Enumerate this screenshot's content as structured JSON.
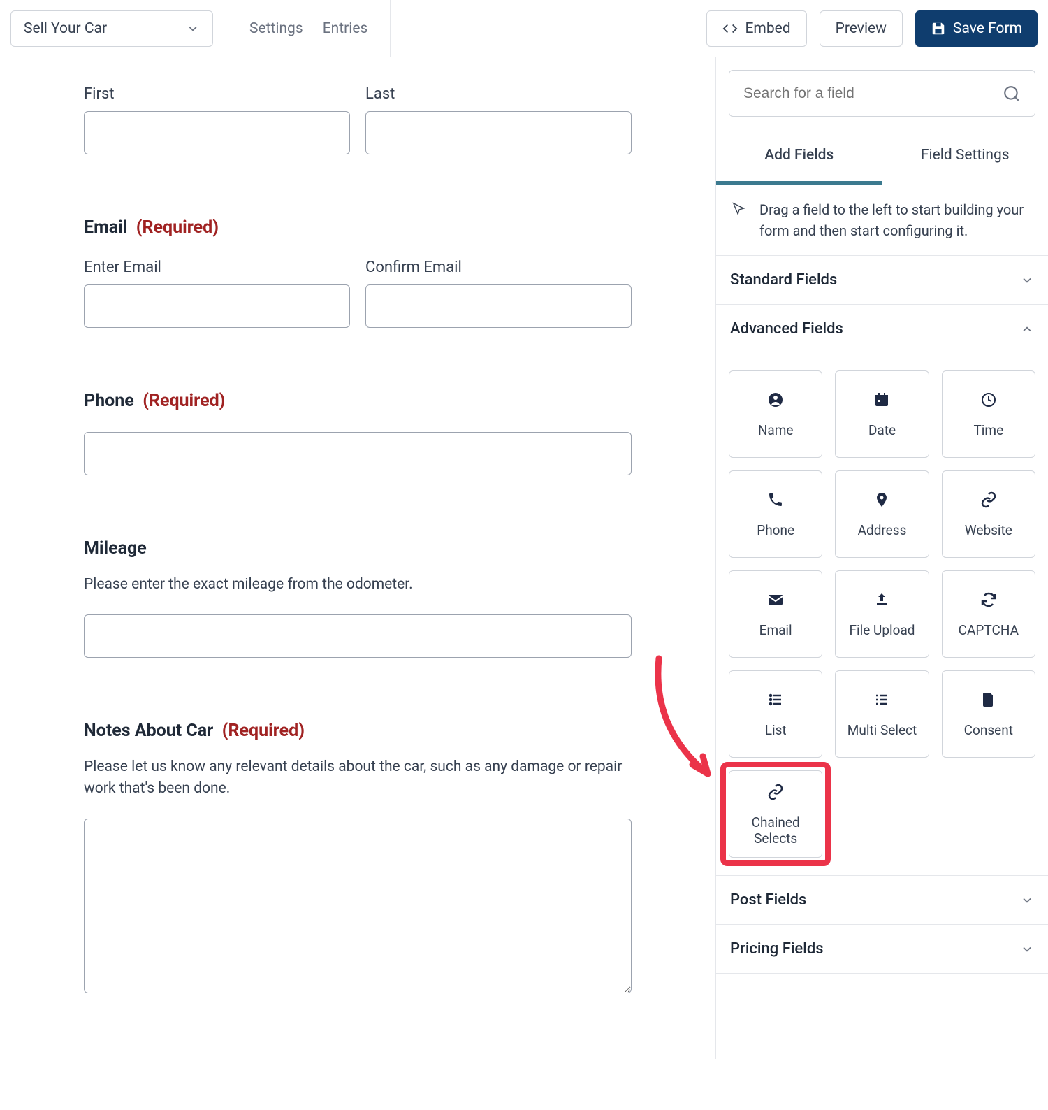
{
  "header": {
    "form_name": "Sell Your Car",
    "tabs": {
      "settings": "Settings",
      "entries": "Entries"
    },
    "embed": "Embed",
    "preview": "Preview",
    "save": "Save Form"
  },
  "form": {
    "first": "First",
    "last": "Last",
    "email_label": "Email",
    "required": "(Required)",
    "enter_email": "Enter Email",
    "confirm_email": "Confirm Email",
    "phone_label": "Phone",
    "mileage_label": "Mileage",
    "mileage_desc": "Please enter the exact mileage from the odometer.",
    "notes_label": "Notes About Car",
    "notes_desc": "Please let us know any relevant details about the car, such as any damage or repair work that's been done."
  },
  "sidebar": {
    "search_placeholder": "Search for a field",
    "tabs": {
      "add": "Add Fields",
      "settings": "Field Settings"
    },
    "hint": "Drag a field to the left to start building your form and then start configuring it.",
    "sections": {
      "standard": "Standard Fields",
      "advanced": "Advanced Fields",
      "post": "Post Fields",
      "pricing": "Pricing Fields"
    },
    "advanced_fields": [
      {
        "icon": "person",
        "label": "Name"
      },
      {
        "icon": "date",
        "label": "Date"
      },
      {
        "icon": "clock",
        "label": "Time"
      },
      {
        "icon": "phone",
        "label": "Phone"
      },
      {
        "icon": "pin",
        "label": "Address"
      },
      {
        "icon": "link",
        "label": "Website"
      },
      {
        "icon": "email",
        "label": "Email"
      },
      {
        "icon": "upload",
        "label": "File Upload"
      },
      {
        "icon": "refresh",
        "label": "CAPTCHA"
      },
      {
        "icon": "list",
        "label": "List"
      },
      {
        "icon": "multi",
        "label": "Multi Select"
      },
      {
        "icon": "doc",
        "label": "Consent"
      },
      {
        "icon": "chain",
        "label": "Chained Selects"
      }
    ]
  }
}
